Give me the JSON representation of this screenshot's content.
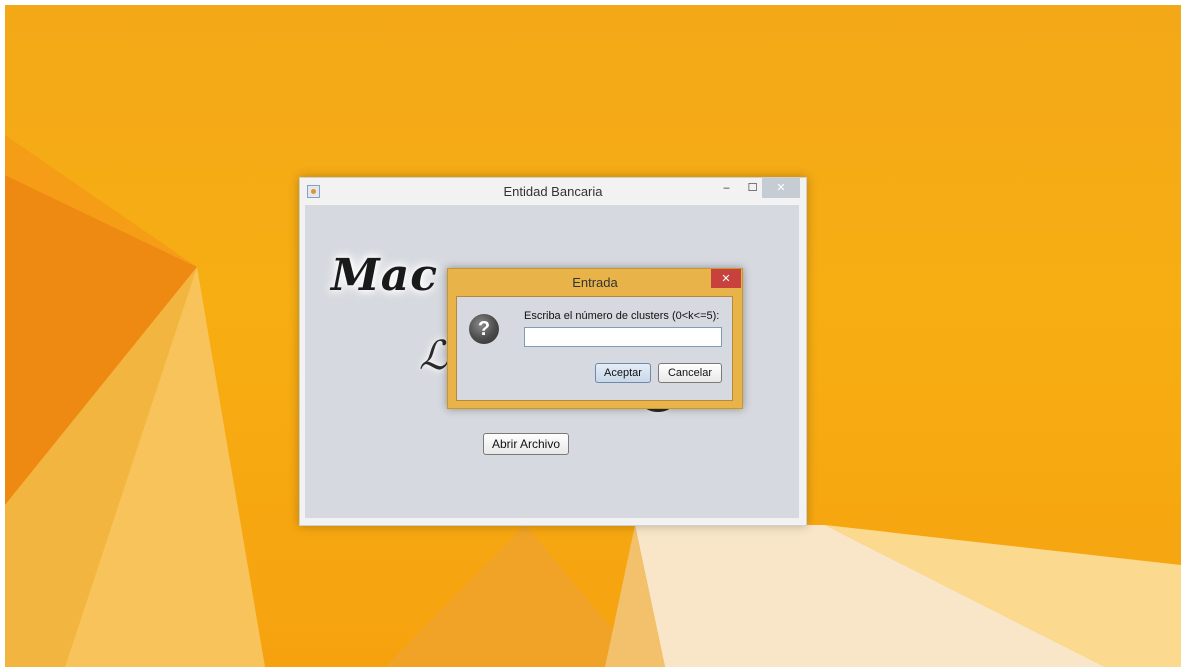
{
  "main_window": {
    "title": "Entidad Bancaria",
    "minimize_glyph": "‒",
    "maximize_glyph": "☐",
    "close_glyph": "✕",
    "logo_text": "Mac",
    "logo_glyph": "ℒ",
    "open_file_label": "Abrir Archivo"
  },
  "dialog": {
    "title": "Entrada",
    "close_glyph": "✕",
    "icon": "question-icon",
    "icon_glyph": "?",
    "prompt": "Escriba el número de clusters (0<k<=5):",
    "input_value": "",
    "accept_label": "Aceptar",
    "cancel_label": "Cancelar"
  },
  "colors": {
    "desktop_orange": "#f6a20f",
    "dialog_frame": "#e8b44a",
    "close_red": "#c7413d"
  }
}
